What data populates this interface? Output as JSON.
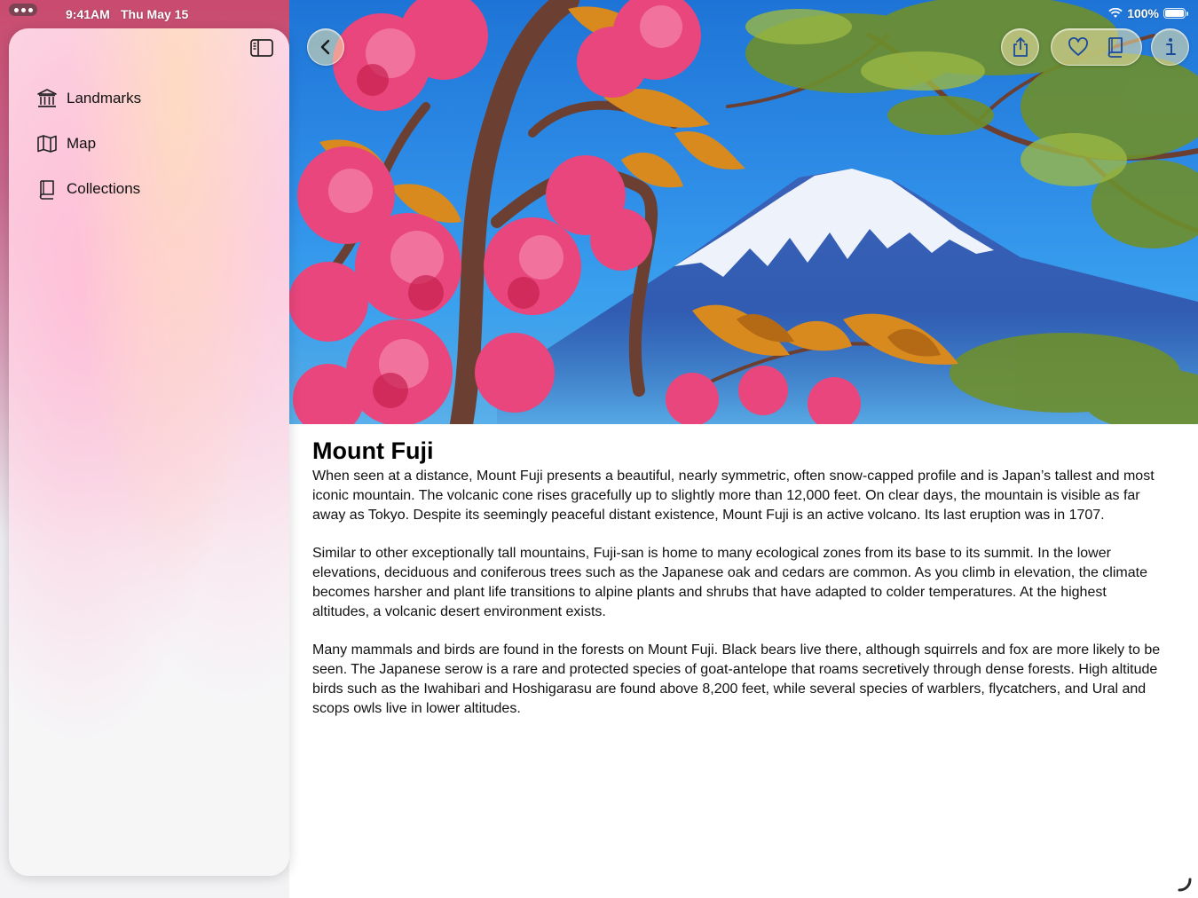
{
  "status_bar": {
    "time": "9:41AM",
    "date": "Thu May 15",
    "battery": "100%"
  },
  "sidebar": {
    "items": [
      {
        "label": "Landmarks",
        "icon": "building-columns-icon"
      },
      {
        "label": "Map",
        "icon": "map-icon"
      },
      {
        "label": "Collections",
        "icon": "book-icon"
      }
    ]
  },
  "toolbar": {
    "back_icon": "chevron-left-icon",
    "share_icon": "share-icon",
    "favorite_icon": "heart-icon",
    "collection_icon": "book-icon",
    "info_icon": "info-icon"
  },
  "landmark": {
    "title": "Mount Fuji",
    "paragraphs": [
      "When seen at a distance, Mount Fuji presents a beautiful, nearly symmetric, often snow-capped profile and is Japan’s tallest and most iconic mountain. The volcanic cone rises gracefully up to slightly more than 12,000 feet. On clear days, the mountain is visible as far away as Tokyo. Despite its seemingly peaceful distant existence, Mount Fuji is an active volcano. Its last eruption was in 1707.",
      "Similar to other exceptionally tall mountains, Fuji-san is home to many ecological zones from its base to its summit. In the lower elevations, deciduous and coniferous trees such as the Japanese oak and cedars are common. As you climb in elevation, the climate becomes harsher and plant life transitions to alpine plants and shrubs that have adapted to colder temperatures. At the highest altitudes, a volcanic desert environment exists.",
      "Many mammals and birds are found in the forests on Mount Fuji. Black bears live there, although squirrels and fox are more likely to be seen. The Japanese serow is a rare and protected species of goat-antelope that roams secretively through dense forests. High altitude birds such as the Iwahibari and Hoshigarasu are found above 8,200 feet, while several species of warblers, flycatchers, and Ural and scops owls live in lower altitudes."
    ]
  },
  "colors": {
    "sky": "#2f8ee8",
    "blossom": "#e8467c",
    "leaf": "#d88a1c",
    "glass_button": "#f5e8aa"
  }
}
